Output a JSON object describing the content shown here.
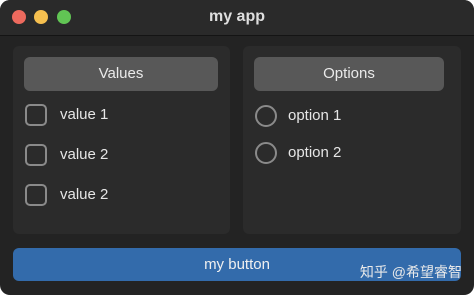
{
  "window": {
    "title": "my app"
  },
  "values_panel": {
    "header": "Values",
    "items": [
      {
        "label": "value 1",
        "checked": false
      },
      {
        "label": "value 2",
        "checked": false
      },
      {
        "label": "value 2",
        "checked": false
      }
    ]
  },
  "options_panel": {
    "header": "Options",
    "items": [
      {
        "label": "option 1",
        "selected": false
      },
      {
        "label": "option 2",
        "selected": false
      }
    ]
  },
  "main_button": {
    "label": "my button"
  },
  "watermark": {
    "text": "知乎 @希望睿智"
  },
  "colors": {
    "window_bg": "#232323",
    "panel_bg": "#2b2b2b",
    "header_bg": "#585858",
    "button_accent": "#336bab",
    "traffic_close": "#ed6a5e",
    "traffic_minimize": "#f5bf4f",
    "traffic_maximize": "#61c554"
  }
}
